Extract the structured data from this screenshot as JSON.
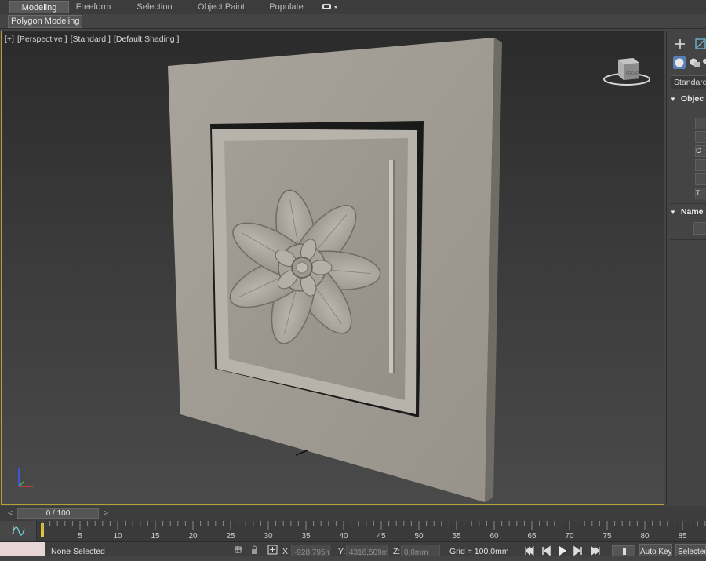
{
  "ribbon": {
    "tabs": [
      {
        "label": "Modeling",
        "active": true
      },
      {
        "label": "Freeform",
        "active": false
      },
      {
        "label": "Selection",
        "active": false
      },
      {
        "label": "Object Paint",
        "active": false
      },
      {
        "label": "Populate",
        "active": false
      }
    ],
    "sub_button": "Polygon Modeling"
  },
  "viewport": {
    "labels": [
      "[+]",
      "[Perspective ]",
      "[Standard ]",
      "[Default Shading ]"
    ],
    "viewcube_face": "FRONT",
    "active_border_color": "#b5a233"
  },
  "command_panel": {
    "category_dropdown": "Standard",
    "rollouts": [
      "Objec",
      "Name"
    ],
    "button_stubs": [
      "",
      "",
      "C",
      "",
      "",
      "T"
    ]
  },
  "time_slider": {
    "current": "0 / 100",
    "prev": "<",
    "next": ">"
  },
  "track_bar": {
    "ticks": [
      "5",
      "10",
      "15",
      "20",
      "25",
      "30",
      "35",
      "40",
      "45",
      "50",
      "55",
      "60",
      "65",
      "70",
      "75",
      "80",
      "85"
    ]
  },
  "status_bar": {
    "selection": "None Selected",
    "x_label": "X:",
    "x_value": "-928,795m",
    "y_label": "Y:",
    "y_value": "4316,509m",
    "z_label": "Z:",
    "z_value": "0,0mm",
    "grid": "Grid = 100,0mm",
    "auto_key": "Auto Key",
    "selected": "Selected"
  },
  "colors": {
    "model": "#9f9a92",
    "viewport_border": "#b5a233"
  }
}
